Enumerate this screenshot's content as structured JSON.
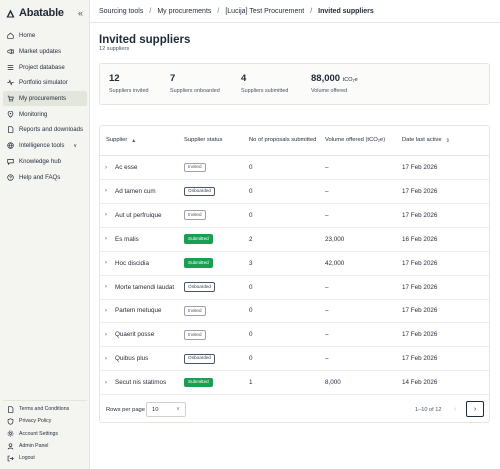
{
  "app": {
    "logo_text": "Abatable"
  },
  "sidebar": {
    "items": [
      {
        "label": "Home",
        "icon": "home-icon"
      },
      {
        "label": "Market updates",
        "icon": "megaphone-icon"
      },
      {
        "label": "Project database",
        "icon": "list-icon"
      },
      {
        "label": "Portfolio simulator",
        "icon": "pulse-icon"
      },
      {
        "label": "My procurements",
        "icon": "cart-icon",
        "active": true
      },
      {
        "label": "Monitoring",
        "icon": "pin-icon"
      },
      {
        "label": "Reports and downloads",
        "icon": "document-icon"
      },
      {
        "label": "Intelligence tools",
        "icon": "globe-icon",
        "chevron": "∨"
      },
      {
        "label": "Knowledge hub",
        "icon": "chat-icon"
      },
      {
        "label": "Help and FAQs",
        "icon": "help-icon"
      }
    ],
    "bottom_items": [
      {
        "label": "Terms and Conditions",
        "icon": "document-icon"
      },
      {
        "label": "Privacy Policy",
        "icon": "shield-icon"
      },
      {
        "label": "Account Settings",
        "icon": "gear-icon"
      },
      {
        "label": "Admin Panel",
        "icon": "person-icon"
      },
      {
        "label": "Logout",
        "icon": "logout-icon"
      }
    ]
  },
  "breadcrumb": {
    "items": [
      "Sourcing tools",
      "My procurements",
      "[Lucija] Test Procurement",
      "Invited suppliers"
    ],
    "separator": "/"
  },
  "page": {
    "title": "Invited suppliers",
    "subtitle": "12 suppliers"
  },
  "stats": [
    {
      "value": "12",
      "label": "Suppliers invited"
    },
    {
      "value": "7",
      "label": "Suppliers onboarded"
    },
    {
      "value": "4",
      "label": "Suppliers submitted"
    },
    {
      "value": "88,000",
      "unit": "tCO₂e",
      "label": "Volume offered"
    }
  ],
  "table": {
    "columns": {
      "supplier": "Supplier",
      "status": "Supplier status",
      "proposals": "No of proposals submitted",
      "volume": "Volume offered (tCO₂e)",
      "date": "Date last active"
    },
    "rows": [
      {
        "supplier": "Ac esse",
        "status": "Invited",
        "proposals": "0",
        "volume": "–",
        "date": "17 Feb 2026"
      },
      {
        "supplier": "Ad tamen cum",
        "status": "Onboarded",
        "proposals": "0",
        "volume": "–",
        "date": "17 Feb 2026"
      },
      {
        "supplier": "Aut ut perfruique",
        "status": "Invited",
        "proposals": "0",
        "volume": "–",
        "date": "17 Feb 2026"
      },
      {
        "supplier": "Es malis",
        "status": "Submitted",
        "proposals": "2",
        "volume": "23,000",
        "date": "16 Feb 2026"
      },
      {
        "supplier": "Hoc discidia",
        "status": "Submitted",
        "proposals": "3",
        "volume": "42,000",
        "date": "17 Feb 2026"
      },
      {
        "supplier": "Morte tamendi laudat",
        "status": "Onboarded",
        "proposals": "0",
        "volume": "–",
        "date": "17 Feb 2026"
      },
      {
        "supplier": "Partem metuque",
        "status": "Invited",
        "proposals": "0",
        "volume": "–",
        "date": "17 Feb 2026"
      },
      {
        "supplier": "Quaerit posse",
        "status": "Invited",
        "proposals": "0",
        "volume": "–",
        "date": "17 Feb 2026"
      },
      {
        "supplier": "Quibus plus",
        "status": "Onboarded",
        "proposals": "0",
        "volume": "–",
        "date": "17 Feb 2026"
      },
      {
        "supplier": "Secut nis statimos",
        "status": "Submitted",
        "proposals": "1",
        "volume": "8,000",
        "date": "14 Feb 2026"
      }
    ]
  },
  "pagination": {
    "rows_per_page_label": "Rows per page",
    "rows_per_page_value": "10",
    "range_text": "1–10 of 12"
  },
  "colors": {
    "submitted_badge": "#1a9e52",
    "sidebar_bg": "#f4f5f1",
    "active_nav_bg": "#e3e6dd"
  }
}
